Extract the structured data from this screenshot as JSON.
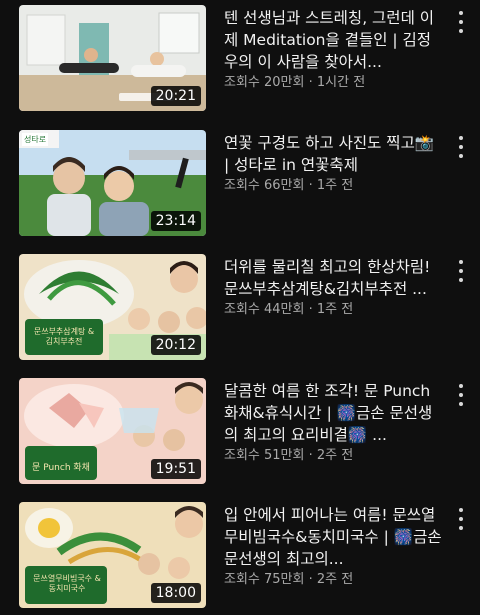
{
  "videos": [
    {
      "title": "텐 선생님과 스트레칭, 그런데 이제 Meditation을 곁들인 | 김정우의 이 사람을 찾아서...",
      "meta": "조회수 20만회 · 1시간 전",
      "duration": "20:21",
      "thumb_colors": [
        "#eef0ee",
        "#d9c6a8",
        "#7cb7b0"
      ],
      "thumb_caption": ""
    },
    {
      "title": "연꽃 구경도 하고 사진도 찍고📸 | 성타로 in 연꽃축제",
      "meta": "조회수 66만회 · 1주 전",
      "duration": "23:14",
      "thumb_colors": [
        "#cfe6f5",
        "#4f8a3a",
        "#e8d2b8"
      ],
      "thumb_caption": "성타로"
    },
    {
      "title": "더위를 물리칠 최고의 한상차림! 문쓰부추삼계탕&김치부추전 ...",
      "meta": "조회수 44만회 · 1주 전",
      "duration": "20:12",
      "thumb_colors": [
        "#f2e3c6",
        "#2f7a3a",
        "#c6e2b0"
      ],
      "thumb_caption": "문쓰부추삼계탕 & 김치부추전"
    },
    {
      "title": "달콤한 여름 한 조각! 문 Punch 화채&휴식시간 | 🎆금손 문선생의 최고의 요리비결🎆 ...",
      "meta": "조회수 51만회 · 2주 전",
      "duration": "19:51",
      "thumb_colors": [
        "#f6d7cf",
        "#1f6b2e",
        "#e9b9b0"
      ],
      "thumb_caption": "문 Punch 화채"
    },
    {
      "title": "입 안에서 피어나는 여름! 문쓰열무비빔국수&동치미국수 | 🎆금손 문선생의 최고의...",
      "meta": "조회수 75만회 · 2주 전",
      "duration": "18:00",
      "thumb_colors": [
        "#f4e6c2",
        "#2d6e33",
        "#d8c39a"
      ],
      "thumb_caption": "문쓰열무비빔국수 & 동치미국수"
    }
  ]
}
